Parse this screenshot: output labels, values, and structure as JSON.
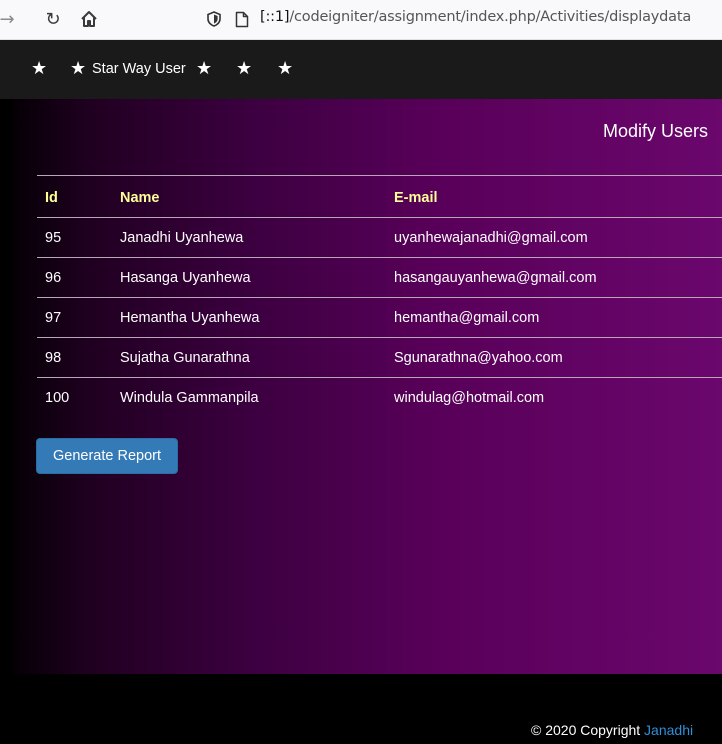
{
  "browser": {
    "url_prefix": "[::1]",
    "url_path": "/codeigniter/assignment/index.php/Activities/displaydata"
  },
  "navbar": {
    "brand": "Star Way User"
  },
  "main": {
    "title": "Modify Users",
    "columns": [
      "Id",
      "Name",
      "E-mail"
    ],
    "rows": [
      {
        "id": "95",
        "name": "Janadhi Uyanhewa",
        "email": "uyanhewajanadhi@gmail.com"
      },
      {
        "id": "96",
        "name": "Hasanga Uyanhewa",
        "email": "hasangauyanhewa@gmail.com"
      },
      {
        "id": "97",
        "name": "Hemantha Uyanhewa",
        "email": "hemantha@gmail.com"
      },
      {
        "id": "98",
        "name": "Sujatha Gunarathna",
        "email": "Sgunarathna@yahoo.com"
      },
      {
        "id": "100",
        "name": "Windula Gammanpila",
        "email": "windulag@hotmail.com"
      }
    ],
    "report_button": "Generate Report"
  },
  "footer": {
    "copyright": "© 2020 Copyright",
    "link": "Janadhi"
  },
  "colors": {
    "header_text": "#ffff99",
    "button": "#337ab7",
    "link": "#2f8fd8"
  }
}
